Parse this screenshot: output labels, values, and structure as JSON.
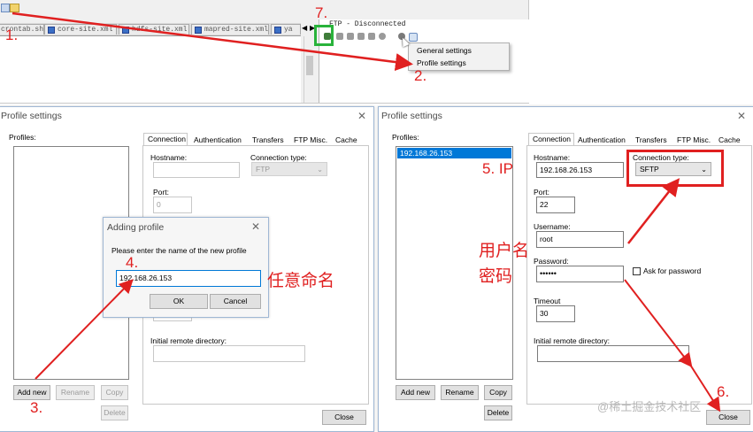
{
  "top": {
    "tabs": [
      "crontab.sh",
      "core-site.xml",
      "hdfs-site.xml",
      "mapred-site.xml",
      "ya"
    ],
    "ftp_title": "FTP - Disconnected",
    "context_menu": [
      "General settings",
      "Profile settings"
    ]
  },
  "left_dialog": {
    "title": "Profile settings",
    "profiles_label": "Profiles:",
    "tabs": [
      "Connection",
      "Authentication",
      "Transfers",
      "FTP Misc.",
      "Cache"
    ],
    "hostname_label": "Hostname:",
    "connection_type_label": "Connection type:",
    "connection_type_value": "FTP",
    "port_label": "Port:",
    "port_value": "0",
    "initial_dir_label": "Initial remote directory:",
    "buttons": {
      "add_new": "Add new",
      "rename": "Rename",
      "copy": "Copy",
      "delete": "Delete",
      "close": "Close"
    }
  },
  "adding_profile": {
    "title": "Adding profile",
    "prompt": "Please enter the name of the new profile",
    "value": "192.168.26.153",
    "ok": "OK",
    "cancel": "Cancel"
  },
  "right_dialog": {
    "title": "Profile settings",
    "profiles_label": "Profiles:",
    "selected_profile": "192.168.26.153",
    "tabs": [
      "Connection",
      "Authentication",
      "Transfers",
      "FTP Misc.",
      "Cache"
    ],
    "hostname_label": "Hostname:",
    "hostname_value": "192.168.26.153",
    "connection_type_label": "Connection type:",
    "connection_type_value": "SFTP",
    "port_label": "Port:",
    "port_value": "22",
    "username_label": "Username:",
    "username_value": "root",
    "password_label": "Password:",
    "password_value": "••••••",
    "ask_password_label": "Ask for password",
    "timeout_label": "Timeout",
    "timeout_value": "30",
    "initial_dir_label": "Initial remote directory:",
    "buttons": {
      "add_new": "Add new",
      "rename": "Rename",
      "copy": "Copy",
      "delete": "Delete",
      "close": "Close"
    }
  },
  "annotations": {
    "step1": "1.",
    "step2": "2.",
    "step3": "3.",
    "step4": "4.",
    "step5": "5. IP",
    "step6": "6.",
    "step7": "7.",
    "name_any": "任意命名",
    "user": "用户名",
    "pwd": "密码"
  },
  "watermark": "@稀土掘金技术社区",
  "colors": {
    "annotation_red": "#e02020",
    "highlight_green": "#29b33b",
    "selection_blue": "#0078d7"
  }
}
